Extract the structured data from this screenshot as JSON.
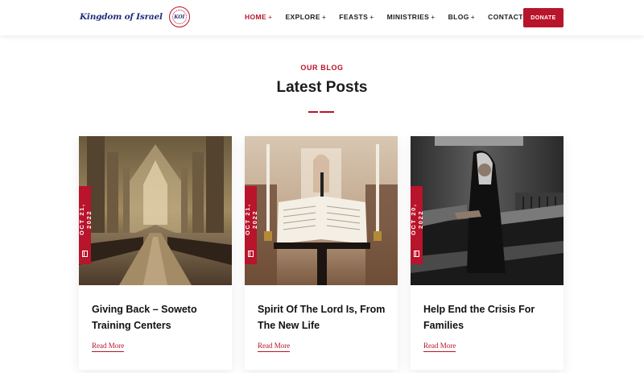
{
  "header": {
    "logo_text": "Kingdom of Israel",
    "logo_seal_text": "KOI",
    "nav": [
      {
        "label": "HOME",
        "plus": "+",
        "active": true
      },
      {
        "label": "EXPLORE",
        "plus": "+",
        "active": false
      },
      {
        "label": "FEASTS",
        "plus": "+",
        "active": false
      },
      {
        "label": "MINISTRIES",
        "plus": "+",
        "active": false
      },
      {
        "label": "BLOG",
        "plus": "+",
        "active": false
      },
      {
        "label": "CONTACT US",
        "plus": "",
        "active": false
      }
    ],
    "donate_label": "DONATE"
  },
  "section": {
    "eyebrow": "OUR BLOG",
    "title": "Latest Posts"
  },
  "posts": [
    {
      "date": "OCT 21, 2022",
      "title": "Giving Back – Soweto Training Centers",
      "read_more": "Read More",
      "image": "cathedral-interior"
    },
    {
      "date": "OCT 21, 2022",
      "title": "Spirit Of The Lord Is, From The New Life",
      "read_more": "Read More",
      "image": "open-bible-lectern"
    },
    {
      "date": "OCT 20, 2022",
      "title": "Help End the Crisis For Families",
      "read_more": "Read More",
      "image": "woman-praying-pew"
    }
  ],
  "colors": {
    "accent": "#b8142b",
    "logo_blue": "#23307a",
    "text": "#1b1b1b"
  }
}
